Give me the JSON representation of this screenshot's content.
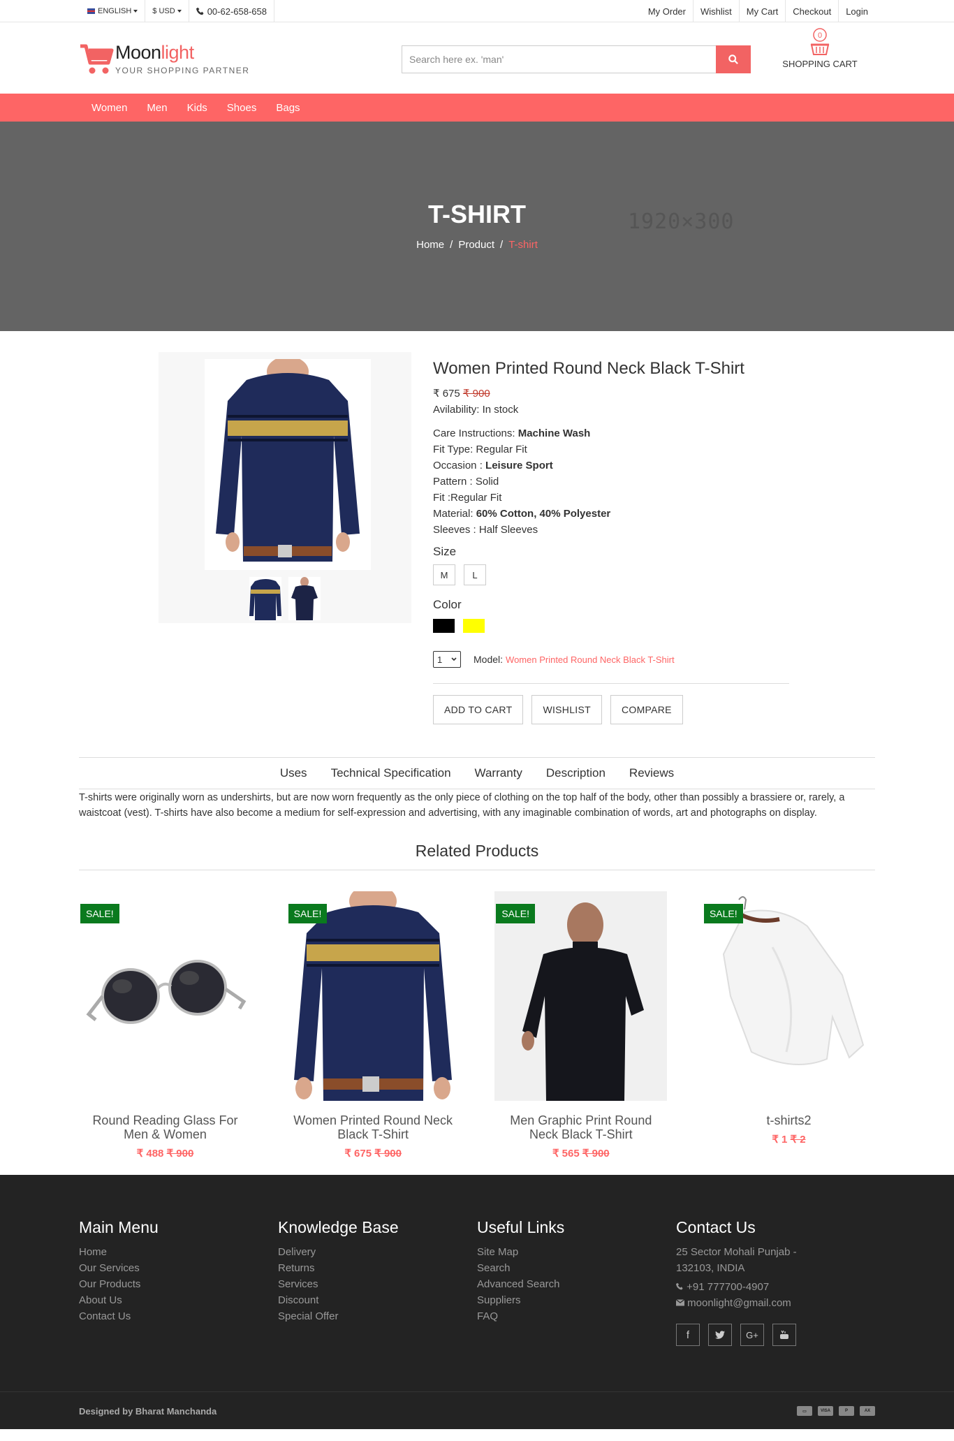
{
  "topbar": {
    "language": "ENGLISH",
    "currency": "$ USD",
    "phone": "00-62-658-658",
    "links": [
      "My Order",
      "Wishlist",
      "My Cart",
      "Checkout",
      "Login"
    ]
  },
  "header": {
    "logo_main": "Moon",
    "logo_accent": "light",
    "tagline": "YOUR SHOPPING PARTNER",
    "search_placeholder": "Search here ex. 'man'",
    "cart_count": "0",
    "cart_label": "SHOPPING CART"
  },
  "nav": [
    "Women",
    "Men",
    "Kids",
    "Shoes",
    "Bags"
  ],
  "hero": {
    "title": "T-SHIRT",
    "crumbs": [
      "Home",
      "Product",
      "T-shirt"
    ],
    "placeholder_dims": "1920×300"
  },
  "product": {
    "title": "Women Printed Round Neck Black T-Shirt",
    "price": "₹ 675",
    "old_price": "₹ 900",
    "availability": "Avilability: In stock",
    "specs": [
      {
        "label": "Care Instructions: ",
        "value": "Machine Wash",
        "bold": true
      },
      {
        "label": "Fit Type: ",
        "value": "Regular Fit",
        "bold": false
      },
      {
        "label": "Occasion : ",
        "value": "Leisure Sport",
        "bold": true
      },
      {
        "label": "Pattern : ",
        "value": "Solid",
        "bold": false
      },
      {
        "label": "Fit :",
        "value": "Regular Fit",
        "bold": false
      },
      {
        "label": "Material: ",
        "value": "60% Cotton, 40% Polyester",
        "bold": true
      },
      {
        "label": "Sleeves : ",
        "value": "Half Sleeves",
        "bold": false
      }
    ],
    "size_label": "Size",
    "sizes": [
      "M",
      "L"
    ],
    "color_label": "Color",
    "colors": [
      "#000000",
      "#ffff00"
    ],
    "quantity": "1",
    "model_label": "Model:",
    "model_value": "Women Printed Round Neck Black T-Shirt",
    "buttons": [
      "ADD TO CART",
      "WISHLIST",
      "COMPARE"
    ]
  },
  "tabs": [
    "Uses",
    "Technical Specification",
    "Warranty",
    "Description",
    "Reviews"
  ],
  "description": "T-shirts were originally worn as undershirts, but are now worn frequently as the only piece of clothing on the top half of the body, other than possibly a brassiere or, rarely, a waistcoat (vest). T-shirts have also become a medium for self-expression and advertising, with any imaginable combination of words, art and photographs on display.",
  "related": {
    "title": "Related Products",
    "sale_label": "SALE!",
    "items": [
      {
        "name": "Round Reading Glass For Men & Women",
        "price": "₹ 488",
        "old": "₹ 900"
      },
      {
        "name": "Women Printed Round Neck Black T-Shirt",
        "price": "₹ 675",
        "old": "₹ 900"
      },
      {
        "name": "Men Graphic Print Round Neck Black T-Shirt",
        "price": "₹ 565",
        "old": "₹ 900"
      },
      {
        "name": "t-shirts2",
        "price": "₹ 1",
        "old": "₹ 2"
      }
    ]
  },
  "footer": {
    "cols": [
      {
        "title": "Main Menu",
        "links": [
          "Home",
          "Our Services",
          "Our Products",
          "About Us",
          "Contact Us"
        ]
      },
      {
        "title": "Knowledge Base",
        "links": [
          "Delivery",
          "Returns",
          "Services",
          "Discount",
          "Special Offer"
        ]
      },
      {
        "title": "Useful Links",
        "links": [
          "Site Map",
          "Search",
          "Advanced Search",
          "Suppliers",
          "FAQ"
        ]
      }
    ],
    "contact": {
      "title": "Contact Us",
      "address": "25 Sector Mohali Punjab - 132103, INDIA",
      "phone": "+91 777700-4907",
      "email": "moonlight@gmail.com"
    },
    "social": [
      "facebook-icon",
      "twitter-icon",
      "google-plus-icon",
      "youtube-icon"
    ],
    "credit": "Designed by Bharat Manchanda",
    "payments": [
      "card-icon",
      "visa-icon",
      "paypal-icon",
      "amex-icon"
    ]
  },
  "colors": {
    "accent": "#fe6565",
    "sale": "#0a7a1e",
    "footer": "#232323",
    "hero": "#646464"
  }
}
